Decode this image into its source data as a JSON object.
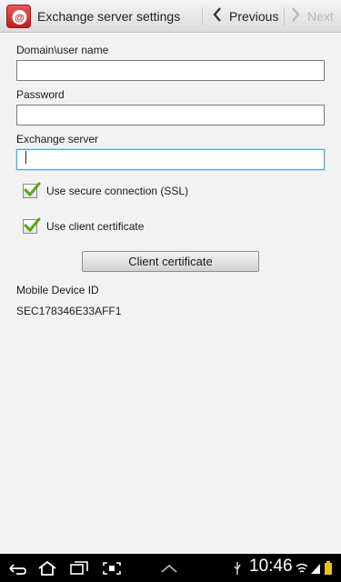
{
  "header": {
    "title": "Exchange server settings",
    "previous_label": "Previous",
    "next_label": "Next"
  },
  "form": {
    "domain_label": "Domain\\user name",
    "domain_value": "",
    "password_label": "Password",
    "password_value": "",
    "server_label": "Exchange server",
    "server_value": "",
    "ssl_label": "Use secure connection (SSL)",
    "ssl_checked": true,
    "client_cert_label": "Use client certificate",
    "client_cert_checked": true,
    "client_cert_button": "Client certificate",
    "device_id_label": "Mobile Device ID",
    "device_id_value": "SEC178346E33AFF1"
  },
  "statusbar": {
    "time": "10:46"
  },
  "colors": {
    "app_icon": "#c62828",
    "focus_border": "#59a7c8",
    "check_green": "#5aa51f"
  }
}
